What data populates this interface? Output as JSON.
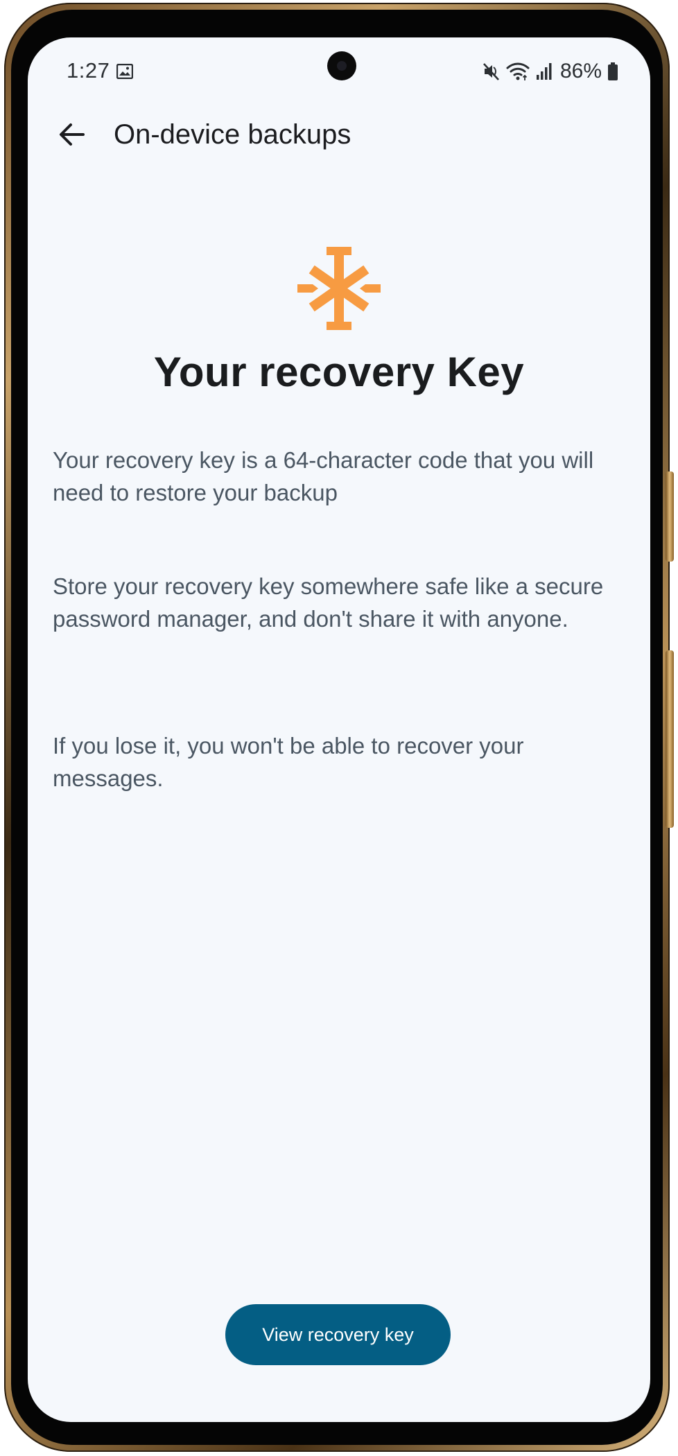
{
  "status_bar": {
    "time": "1:27",
    "battery": "86%"
  },
  "app_bar": {
    "title": "On-device backups"
  },
  "content": {
    "headline": "Your recovery Key",
    "paragraphs": [
      "Your recovery key is a 64-character code that you will need to restore your backup",
      "Store your recovery key somewhere safe like a secure password manager, and don't share it with anyone.",
      "If you lose it, you won't be able to recover your messages."
    ]
  },
  "actions": {
    "primary_label": "View recovery key"
  },
  "icons": {
    "status": [
      "gallery-icon",
      "mute-icon",
      "wifi-icon",
      "signal-icon",
      "battery-icon"
    ],
    "back": "back-arrow-icon",
    "hero": "asterisk-key-icon"
  },
  "colors": {
    "screen_background": "#f5f8fc",
    "accent_orange": "#f79b42",
    "primary_button": "#045e84",
    "body_text": "#4a5662",
    "headline_text": "#1a1c1e"
  }
}
